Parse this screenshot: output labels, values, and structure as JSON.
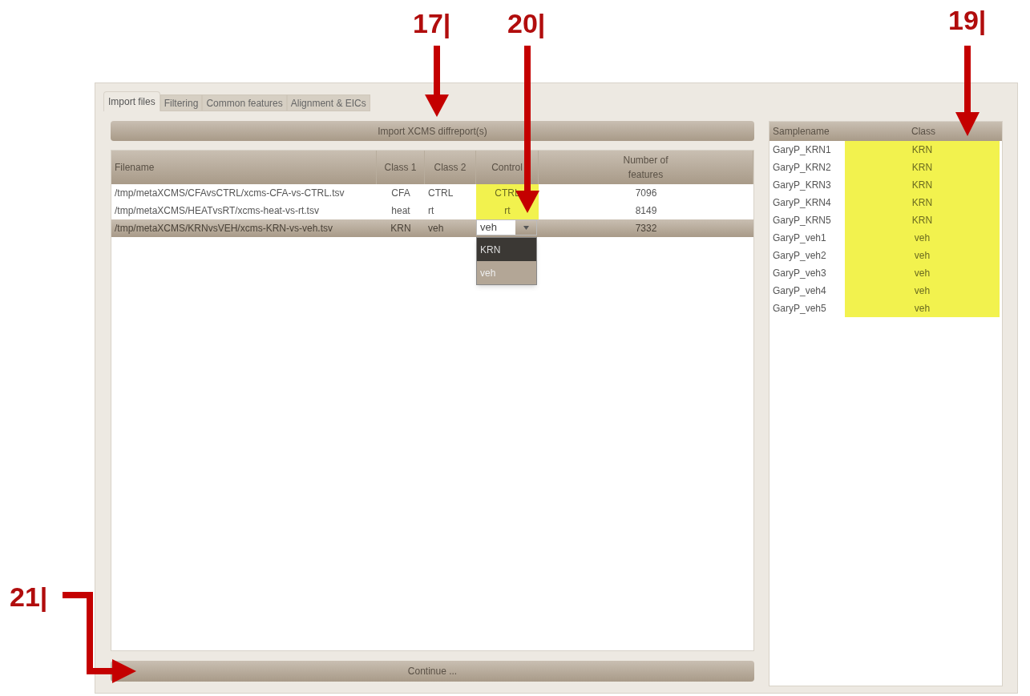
{
  "callouts": [
    {
      "label": "17|"
    },
    {
      "label": "20|"
    },
    {
      "label": "19|"
    },
    {
      "label": "21|"
    }
  ],
  "tabs": [
    {
      "label": "Import files",
      "selected": true
    },
    {
      "label": "Filtering",
      "selected": false
    },
    {
      "label": "Common features",
      "selected": false
    },
    {
      "label": "Alignment & EICs",
      "selected": false
    }
  ],
  "import_button": "Import XCMS diffreport(s)",
  "files_table": {
    "columns": [
      "Filename",
      "Class 1",
      "Class 2",
      "Control",
      "Number of features"
    ],
    "rows": [
      {
        "filename": "/tmp/metaXCMS/CFAvsCTRL/xcms-CFA-vs-CTRL.tsv",
        "class_1": "CFA",
        "class_2": "CTRL",
        "control": "CTRL",
        "features": "7096",
        "selected": false,
        "kind": "text"
      },
      {
        "filename": "/tmp/metaXCMS/HEATvsRT/xcms-heat-vs-rt.tsv",
        "class_1": "heat",
        "class_2": "rt",
        "control": "rt",
        "features": "8149",
        "selected": false,
        "kind": "text"
      },
      {
        "filename": "/tmp/metaXCMS/KRNvsVEH/xcms-KRN-vs-veh.tsv",
        "class_1": "KRN",
        "class_2": "veh",
        "control": "veh",
        "features": "7332",
        "selected": true,
        "kind": "combo",
        "options": [
          {
            "label": "KRN",
            "selected": true
          },
          {
            "label": "veh",
            "selected": false
          }
        ]
      }
    ]
  },
  "continue_button": "Continue ...",
  "samples_table": {
    "columns": [
      "Samplename",
      "Class"
    ],
    "rows": [
      {
        "name": "GaryP_KRN1",
        "class": "KRN"
      },
      {
        "name": "GaryP_KRN2",
        "class": "KRN"
      },
      {
        "name": "GaryP_KRN3",
        "class": "KRN"
      },
      {
        "name": "GaryP_KRN4",
        "class": "KRN"
      },
      {
        "name": "GaryP_KRN5",
        "class": "KRN"
      },
      {
        "name": "GaryP_veh1",
        "class": "veh"
      },
      {
        "name": "GaryP_veh2",
        "class": "veh"
      },
      {
        "name": "GaryP_veh3",
        "class": "veh"
      },
      {
        "name": "GaryP_veh4",
        "class": "veh"
      },
      {
        "name": "GaryP_veh5",
        "class": "veh"
      }
    ]
  }
}
